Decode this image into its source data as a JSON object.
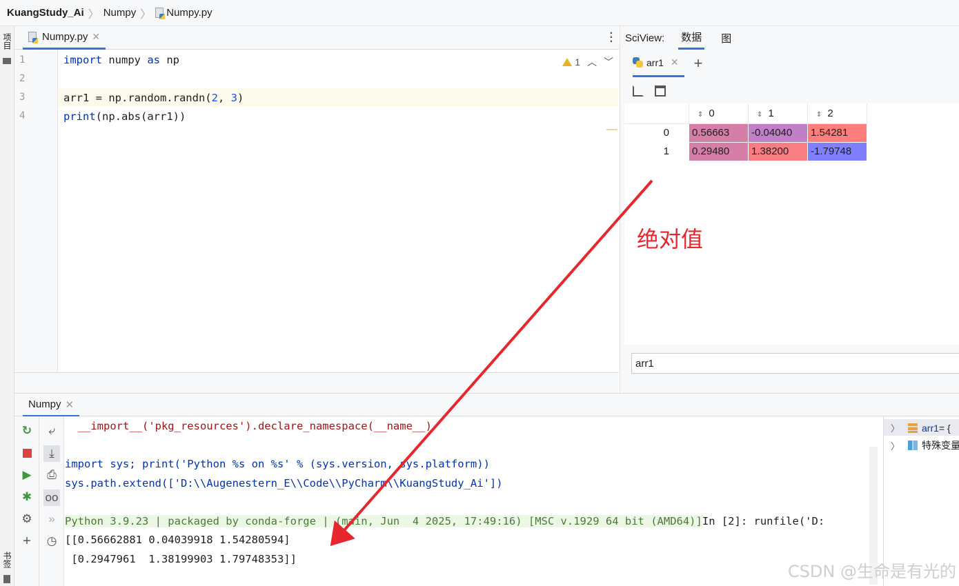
{
  "breadcrumb": {
    "project": "KuangStudy_Ai",
    "folder": "Numpy",
    "file": "Numpy.py"
  },
  "left_stripe": {
    "project_tab": "项目",
    "bookmarks_tab": "书签"
  },
  "editor": {
    "tab_label": "Numpy.py",
    "warning_count": "1",
    "line_numbers": [
      "1",
      "2",
      "3",
      "4"
    ],
    "lines": [
      {
        "kw1": "import",
        "t1": " numpy ",
        "kw2": "as",
        "t2": " np"
      },
      {},
      {
        "t1": "arr1 = np.random.randn(",
        "n1": "2",
        "t2": ", ",
        "n2": "3",
        "t3": ")"
      },
      {
        "kw1": "print",
        "t1": "(np.abs(arr1))"
      }
    ]
  },
  "sciview": {
    "title": "SciView:",
    "tabs": [
      "数据",
      "图"
    ],
    "active_tab": 0,
    "array_tab": "arr1",
    "columns": [
      "0",
      "1",
      "2"
    ],
    "rows": [
      {
        "index": "0",
        "cells": [
          "0.56663",
          "-0.04040",
          "1.54281"
        ],
        "colors": [
          "#d57ea8",
          "#c07fc7",
          "#ff7d7d"
        ]
      },
      {
        "index": "1",
        "cells": [
          "0.29480",
          "1.38200",
          "-1.79748"
        ],
        "colors": [
          "#d57ea8",
          "#fb7d84",
          "#7f7fff"
        ]
      }
    ],
    "slice_input": "arr1"
  },
  "console": {
    "tab_label": "Numpy",
    "lines": [
      {
        "text": "  __import__('pkg_resources').declare_namespace(__name__)",
        "color": "#a31515"
      },
      {
        "text": "",
        "color": "#1e1e1e"
      },
      {
        "text": "import sys; print('Python %s on %s' % (sys.version, sys.platform))",
        "color": "#0033b3"
      },
      {
        "text": "sys.path.extend(['D:\\\\Augenestern_E\\\\Code\\\\PyCharm\\\\KuangStudy_Ai'])",
        "color": "#0033b3"
      },
      {
        "text": "",
        "color": "#1e1e1e"
      },
      {
        "text": "Python 3.9.23 | packaged by conda-forge | (main, Jun  4 2025, 17:49:16) [MSC v.1929 64 bit (AMD64)]",
        "color": "#4a7a3a",
        "suffix": "In [2]: runfile('D:",
        "suffix_color": "#1e1e1e",
        "prompt": "In [2]: ",
        "prompt_color": "#067d17"
      },
      {
        "text": "[[0.56662881 0.04039918 1.54280594]",
        "color": "#1e1e1e"
      },
      {
        "text": " [0.2947961  1.38199903 1.79748353]]",
        "color": "#1e1e1e"
      }
    ]
  },
  "variables": [
    {
      "name": "arr1",
      "value": " = {",
      "name_color": "#0033b3"
    },
    {
      "name": "特殊变量",
      "value": "",
      "name_color": "#1e1e1e"
    }
  ],
  "annotation": {
    "label": "绝对值",
    "color": "#e8262d"
  },
  "watermark": "CSDN @生命是有光的"
}
